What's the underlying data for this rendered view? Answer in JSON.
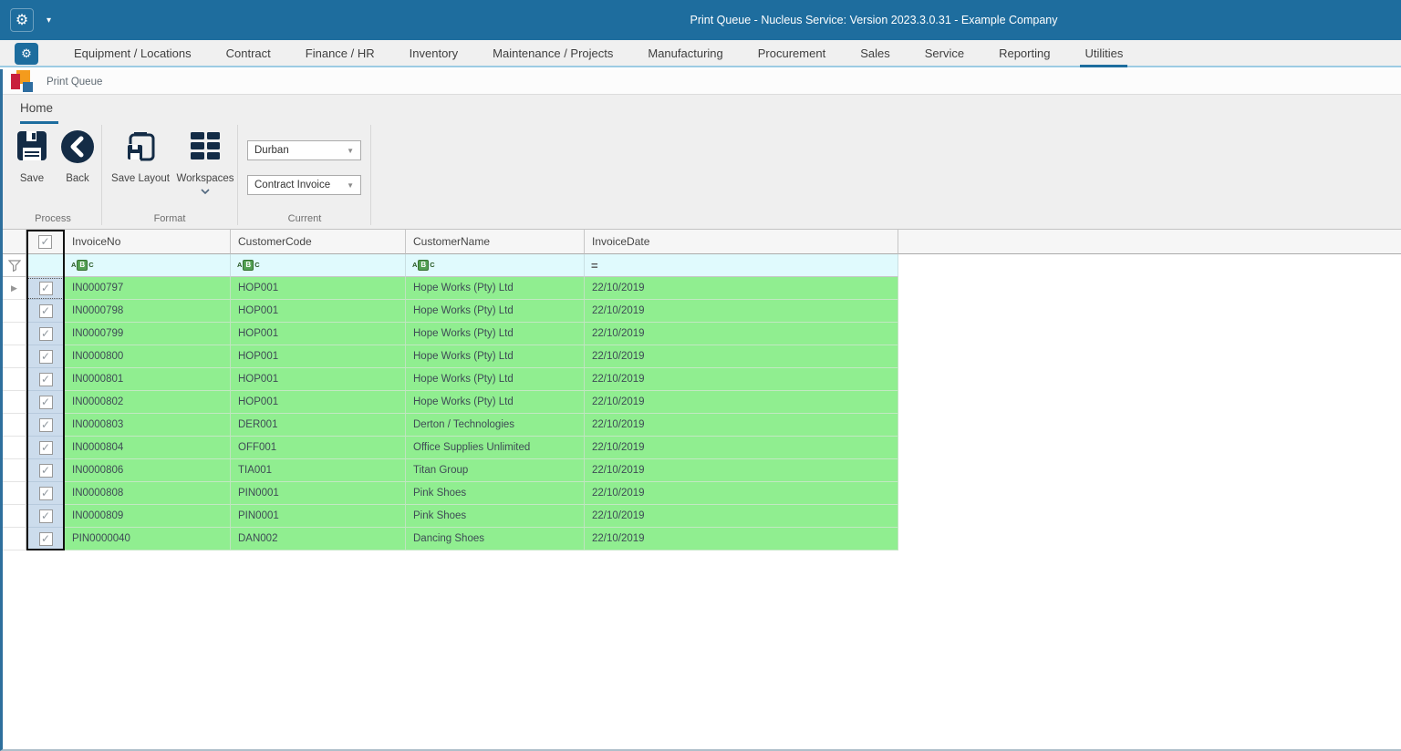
{
  "titlebar": {
    "title": "Print Queue - Nucleus Service: Version 2023.3.0.31 - Example Company"
  },
  "menu": {
    "tabs": [
      {
        "label": "Equipment / Locations",
        "active": false
      },
      {
        "label": "Contract",
        "active": false
      },
      {
        "label": "Finance / HR",
        "active": false
      },
      {
        "label": "Inventory",
        "active": false
      },
      {
        "label": "Maintenance / Projects",
        "active": false
      },
      {
        "label": "Manufacturing",
        "active": false
      },
      {
        "label": "Procurement",
        "active": false
      },
      {
        "label": "Sales",
        "active": false
      },
      {
        "label": "Service",
        "active": false
      },
      {
        "label": "Reporting",
        "active": false
      },
      {
        "label": "Utilities",
        "active": true
      }
    ]
  },
  "breadcrumb": {
    "label": "Print Queue"
  },
  "ribbon": {
    "active_tab": "Home",
    "buttons": {
      "save": "Save",
      "back": "Back",
      "save_layout": "Save Layout",
      "workspaces": "Workspaces"
    },
    "dropdowns": {
      "branch_value": "Durban",
      "document_value": "Contract Invoice"
    },
    "group_labels": {
      "process": "Process",
      "format": "Format",
      "current": "Current"
    }
  },
  "grid": {
    "columns": [
      "InvoiceNo",
      "CustomerCode",
      "CustomerName",
      "InvoiceDate"
    ],
    "select_all_checked": true,
    "rows": [
      {
        "checked": true,
        "invoice_no": "IN0000797",
        "customer_code": "HOP001",
        "customer_name": "Hope Works (Pty) Ltd",
        "invoice_date": "22/10/2019"
      },
      {
        "checked": true,
        "invoice_no": "IN0000798",
        "customer_code": "HOP001",
        "customer_name": "Hope Works (Pty) Ltd",
        "invoice_date": "22/10/2019"
      },
      {
        "checked": true,
        "invoice_no": "IN0000799",
        "customer_code": "HOP001",
        "customer_name": "Hope Works (Pty) Ltd",
        "invoice_date": "22/10/2019"
      },
      {
        "checked": true,
        "invoice_no": "IN0000800",
        "customer_code": "HOP001",
        "customer_name": "Hope Works (Pty) Ltd",
        "invoice_date": "22/10/2019"
      },
      {
        "checked": true,
        "invoice_no": "IN0000801",
        "customer_code": "HOP001",
        "customer_name": "Hope Works (Pty) Ltd",
        "invoice_date": "22/10/2019"
      },
      {
        "checked": true,
        "invoice_no": "IN0000802",
        "customer_code": "HOP001",
        "customer_name": "Hope Works (Pty) Ltd",
        "invoice_date": "22/10/2019"
      },
      {
        "checked": true,
        "invoice_no": "IN0000803",
        "customer_code": "DER001",
        "customer_name": "Derton / Technologies",
        "invoice_date": "22/10/2019"
      },
      {
        "checked": true,
        "invoice_no": "IN0000804",
        "customer_code": "OFF001",
        "customer_name": "Office Supplies Unlimited",
        "invoice_date": "22/10/2019"
      },
      {
        "checked": true,
        "invoice_no": "IN0000806",
        "customer_code": "TIA001",
        "customer_name": "Titan Group",
        "invoice_date": "22/10/2019"
      },
      {
        "checked": true,
        "invoice_no": "IN0000808",
        "customer_code": "PIN0001",
        "customer_name": "Pink Shoes",
        "invoice_date": "22/10/2019"
      },
      {
        "checked": true,
        "invoice_no": "IN0000809",
        "customer_code": "PIN0001",
        "customer_name": "Pink Shoes",
        "invoice_date": "22/10/2019"
      },
      {
        "checked": true,
        "invoice_no": "PIN0000040",
        "customer_code": "DAN002",
        "customer_name": "Dancing Shoes",
        "invoice_date": "22/10/2019"
      }
    ]
  },
  "colors": {
    "accent_blue": "#1d6d9e",
    "icon_navy": "#142c46",
    "row_green": "#90ee90",
    "filter_cyan": "#e0fafd",
    "checkbox_cell_blue": "#ccdcec"
  }
}
